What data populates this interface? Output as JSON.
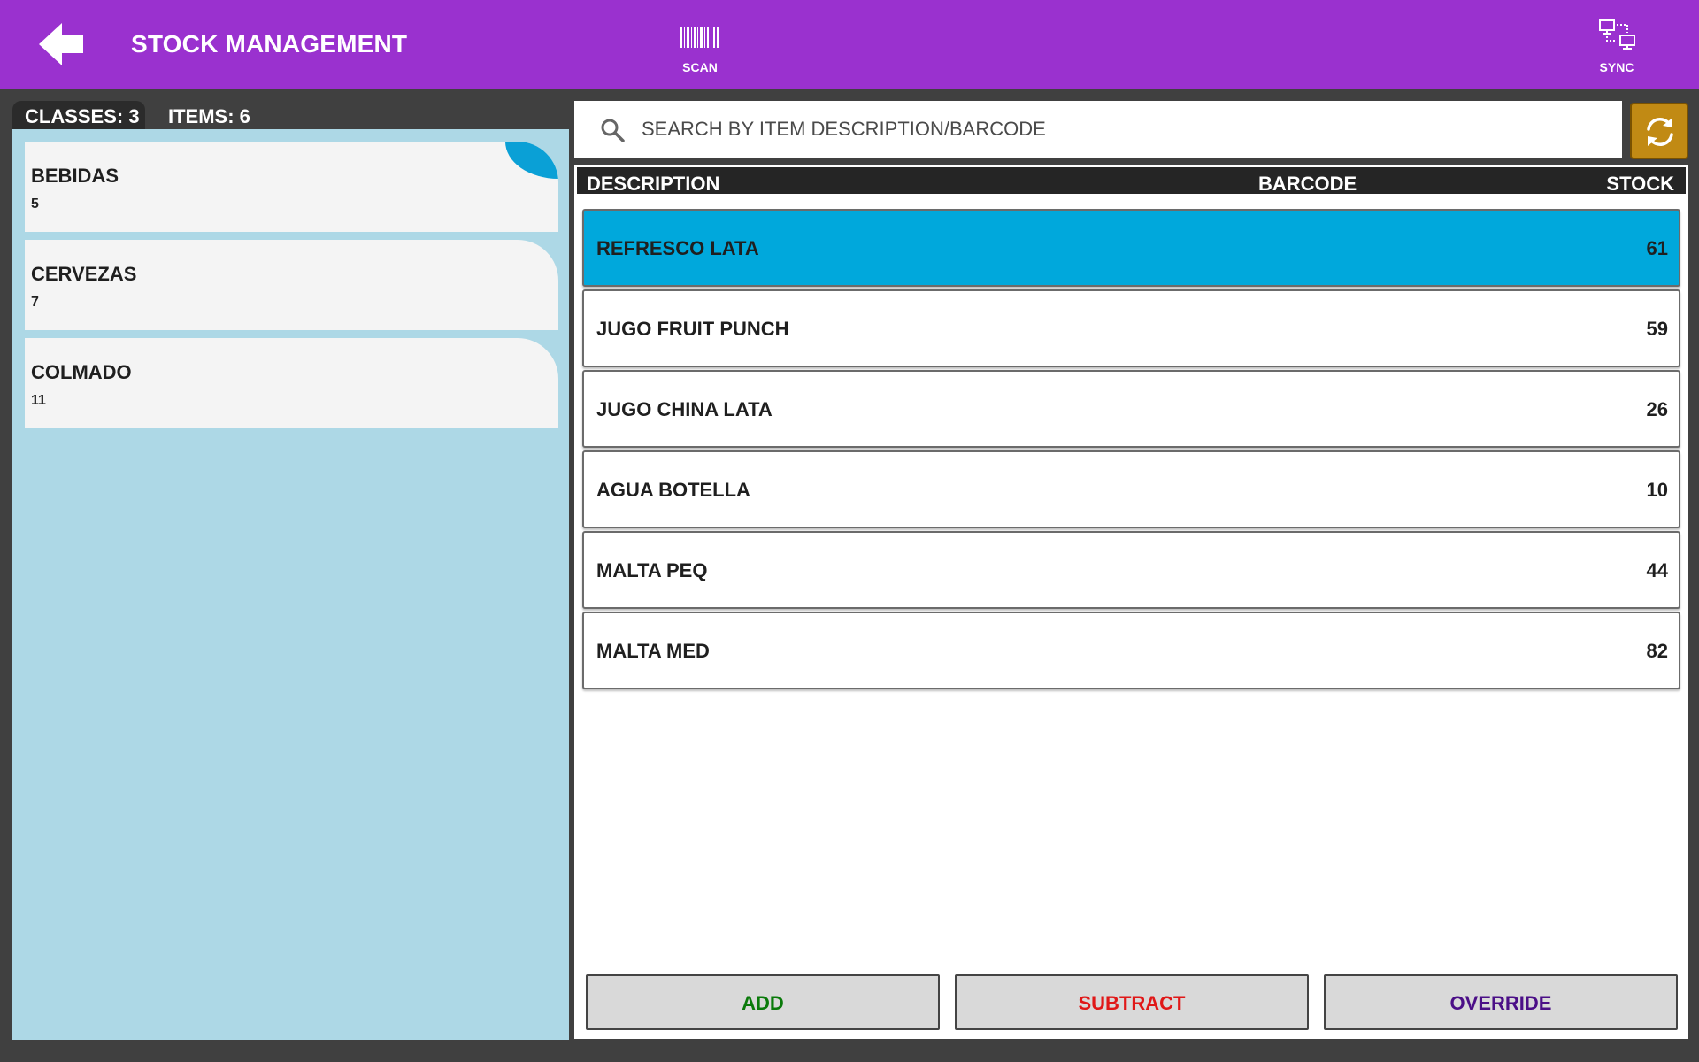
{
  "header": {
    "title": "STOCK MANAGEMENT",
    "back_icon": "back-arrow-icon",
    "scan": {
      "label": "SCAN",
      "icon": "barcode-icon"
    },
    "sync": {
      "label": "SYNC",
      "icon": "sync-network-icon"
    },
    "bg_color": "#9a31cf"
  },
  "summary": {
    "classes_label": "CLASSES: 3",
    "items_label": "ITEMS: 6"
  },
  "classes": [
    {
      "name": "BEBIDAS",
      "count": "5",
      "selected": true
    },
    {
      "name": "CERVEZAS",
      "count": "7",
      "selected": false
    },
    {
      "name": "COLMADO",
      "count": "11",
      "selected": false
    }
  ],
  "search": {
    "placeholder": "SEARCH BY ITEM DESCRIPTION/BARCODE",
    "value": ""
  },
  "table": {
    "columns": {
      "description": "DESCRIPTION",
      "barcode": "BARCODE",
      "stock": "STOCK"
    },
    "rows": [
      {
        "description": "REFRESCO LATA",
        "barcode": "",
        "stock": "61",
        "selected": true
      },
      {
        "description": "JUGO FRUIT PUNCH",
        "barcode": "",
        "stock": "59",
        "selected": false
      },
      {
        "description": "JUGO CHINA LATA",
        "barcode": "",
        "stock": "26",
        "selected": false
      },
      {
        "description": "AGUA BOTELLA",
        "barcode": "",
        "stock": "10",
        "selected": false
      },
      {
        "description": "MALTA PEQ",
        "barcode": "",
        "stock": "44",
        "selected": false
      },
      {
        "description": "MALTA MED",
        "barcode": "",
        "stock": "82",
        "selected": false
      }
    ]
  },
  "actions": {
    "add": "ADD",
    "subtract": "SUBTRACT",
    "override": "OVERRIDE"
  },
  "colors": {
    "selected_row": "#00a8dc",
    "class_panel": "#add8e6",
    "refresh_button": "#c18a14",
    "add_text": "#0a7a0a",
    "subtract_text": "#e01818",
    "override_text": "#4b0f87"
  }
}
